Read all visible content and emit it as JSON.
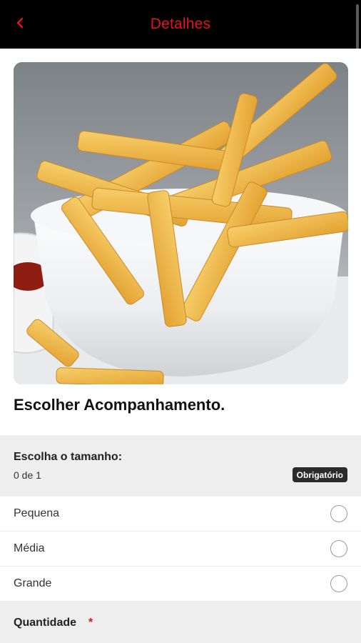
{
  "app_bar": {
    "title": "Detalhes",
    "back_icon": "chevron-left-icon",
    "accent_color": "#e8101c",
    "background": "#000000"
  },
  "product": {
    "image_subject": "french-fries-bowl",
    "title": "Escolher Acompanhamento."
  },
  "size_group": {
    "label": "Escolha o tamanho:",
    "count": "0 de 1",
    "badge": "Obrigatório",
    "options": [
      {
        "label": "Pequena",
        "selected": false
      },
      {
        "label": "Média",
        "selected": false
      },
      {
        "label": "Grande",
        "selected": false
      }
    ]
  },
  "quantity": {
    "label": "Quantidade",
    "required_marker": "*"
  }
}
